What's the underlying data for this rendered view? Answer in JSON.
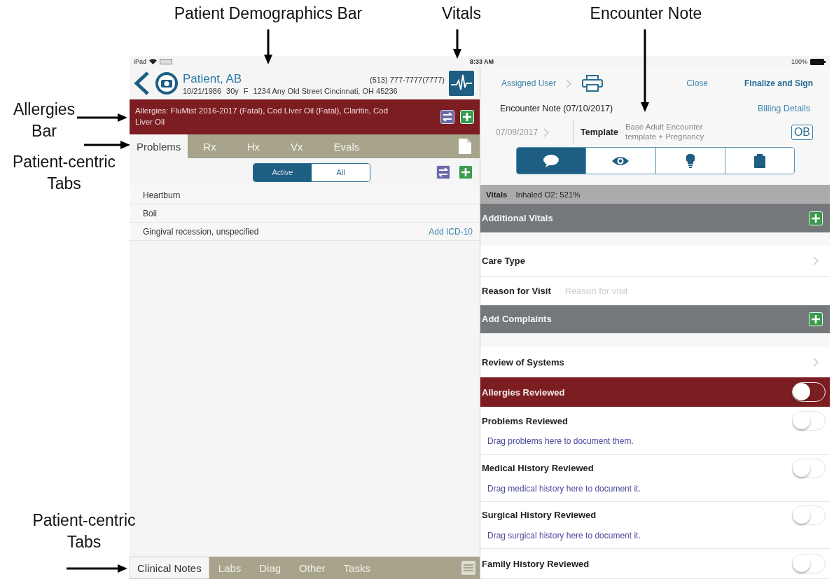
{
  "annotations": [
    {
      "text": "Patient Demographics Bar"
    },
    {
      "text": "Vitals"
    },
    {
      "text": "Encounter Note"
    },
    {
      "text": "Allergies Bar"
    },
    {
      "text": "Patient-centric Tabs"
    },
    {
      "text": "Patient-centric Tabs"
    }
  ],
  "status_bar": {
    "device": "iPad",
    "time": "8:33 AM",
    "battery": "100%"
  },
  "patient": {
    "name": "Patient, AB",
    "dob": "10/21/1986",
    "age": "30y",
    "sex": "F",
    "address": "1234 Any Old Street Cincinnati, OH 45236",
    "phone": "(513) 777-7777(7777)"
  },
  "allergies": {
    "text": "Allergies:  FluMist 2016-2017 (Fatal), Cod Liver Oil (Fatal), Claritin, Cod Liver Oil"
  },
  "tabs": [
    {
      "label": "Problems",
      "selected": true
    },
    {
      "label": "Rx",
      "selected": false
    },
    {
      "label": "Hx",
      "selected": false
    },
    {
      "label": "Vx",
      "selected": false
    },
    {
      "label": "Evals",
      "selected": false
    }
  ],
  "filter": [
    {
      "label": "Active",
      "selected": true
    },
    {
      "label": "All",
      "selected": false
    }
  ],
  "problems": [
    {
      "name": "Heartburn"
    },
    {
      "name": "Boil"
    },
    {
      "name": "Gingival recession, unspecified",
      "action": "Add ICD-10"
    }
  ],
  "bottom_tabs": [
    {
      "label": "Clinical Notes",
      "selected": true
    },
    {
      "label": "Labs",
      "selected": false
    },
    {
      "label": "Diag",
      "selected": false
    },
    {
      "label": "Other",
      "selected": false
    },
    {
      "label": "Tasks",
      "selected": false
    }
  ],
  "encounter": {
    "assigned_user": "Assigned User",
    "close": "Close",
    "finalize": "Finalize and Sign",
    "title": "Encounter Note (07/10/2017)",
    "billing": "Billing Details",
    "date": "07/09/2017",
    "template_label": "Template",
    "template": "Base Adult Encounter template + Pregnancy",
    "badge": "OB"
  },
  "note_tabs": [
    {
      "kind": "chat",
      "selected": true
    },
    {
      "kind": "eye",
      "selected": false
    },
    {
      "kind": "bulb",
      "selected": false
    },
    {
      "kind": "clipboard",
      "selected": false
    }
  ],
  "vitals": {
    "label": "Vitals",
    "value": "Inhaled O2: 521%"
  },
  "sections": [
    {
      "kind": "header",
      "label": "Additional Vitals"
    },
    {
      "kind": "nav",
      "label": "Care Type"
    },
    {
      "kind": "field",
      "label": "Reason for Visit",
      "placeholder": "Reason for visit"
    },
    {
      "kind": "header",
      "label": "Add Complaints"
    },
    {
      "kind": "nav",
      "label": "Review of Systems"
    },
    {
      "kind": "toggle",
      "label": "Allergies Reviewed",
      "alert": true,
      "on": false
    },
    {
      "kind": "toggle",
      "label": "Problems Reviewed",
      "hint": "Drag problems here to document them.",
      "alert": false,
      "on": false
    },
    {
      "kind": "toggle",
      "label": "Medical History Reviewed",
      "hint": "Drag medical history here to document it.",
      "alert": false,
      "on": false
    },
    {
      "kind": "toggle",
      "label": "Surgical History Reviewed",
      "hint": "Drag surgical history here to document it.",
      "alert": false,
      "on": false
    },
    {
      "kind": "toggle",
      "label": "Family History Reviewed",
      "alert": false,
      "on": false
    }
  ]
}
